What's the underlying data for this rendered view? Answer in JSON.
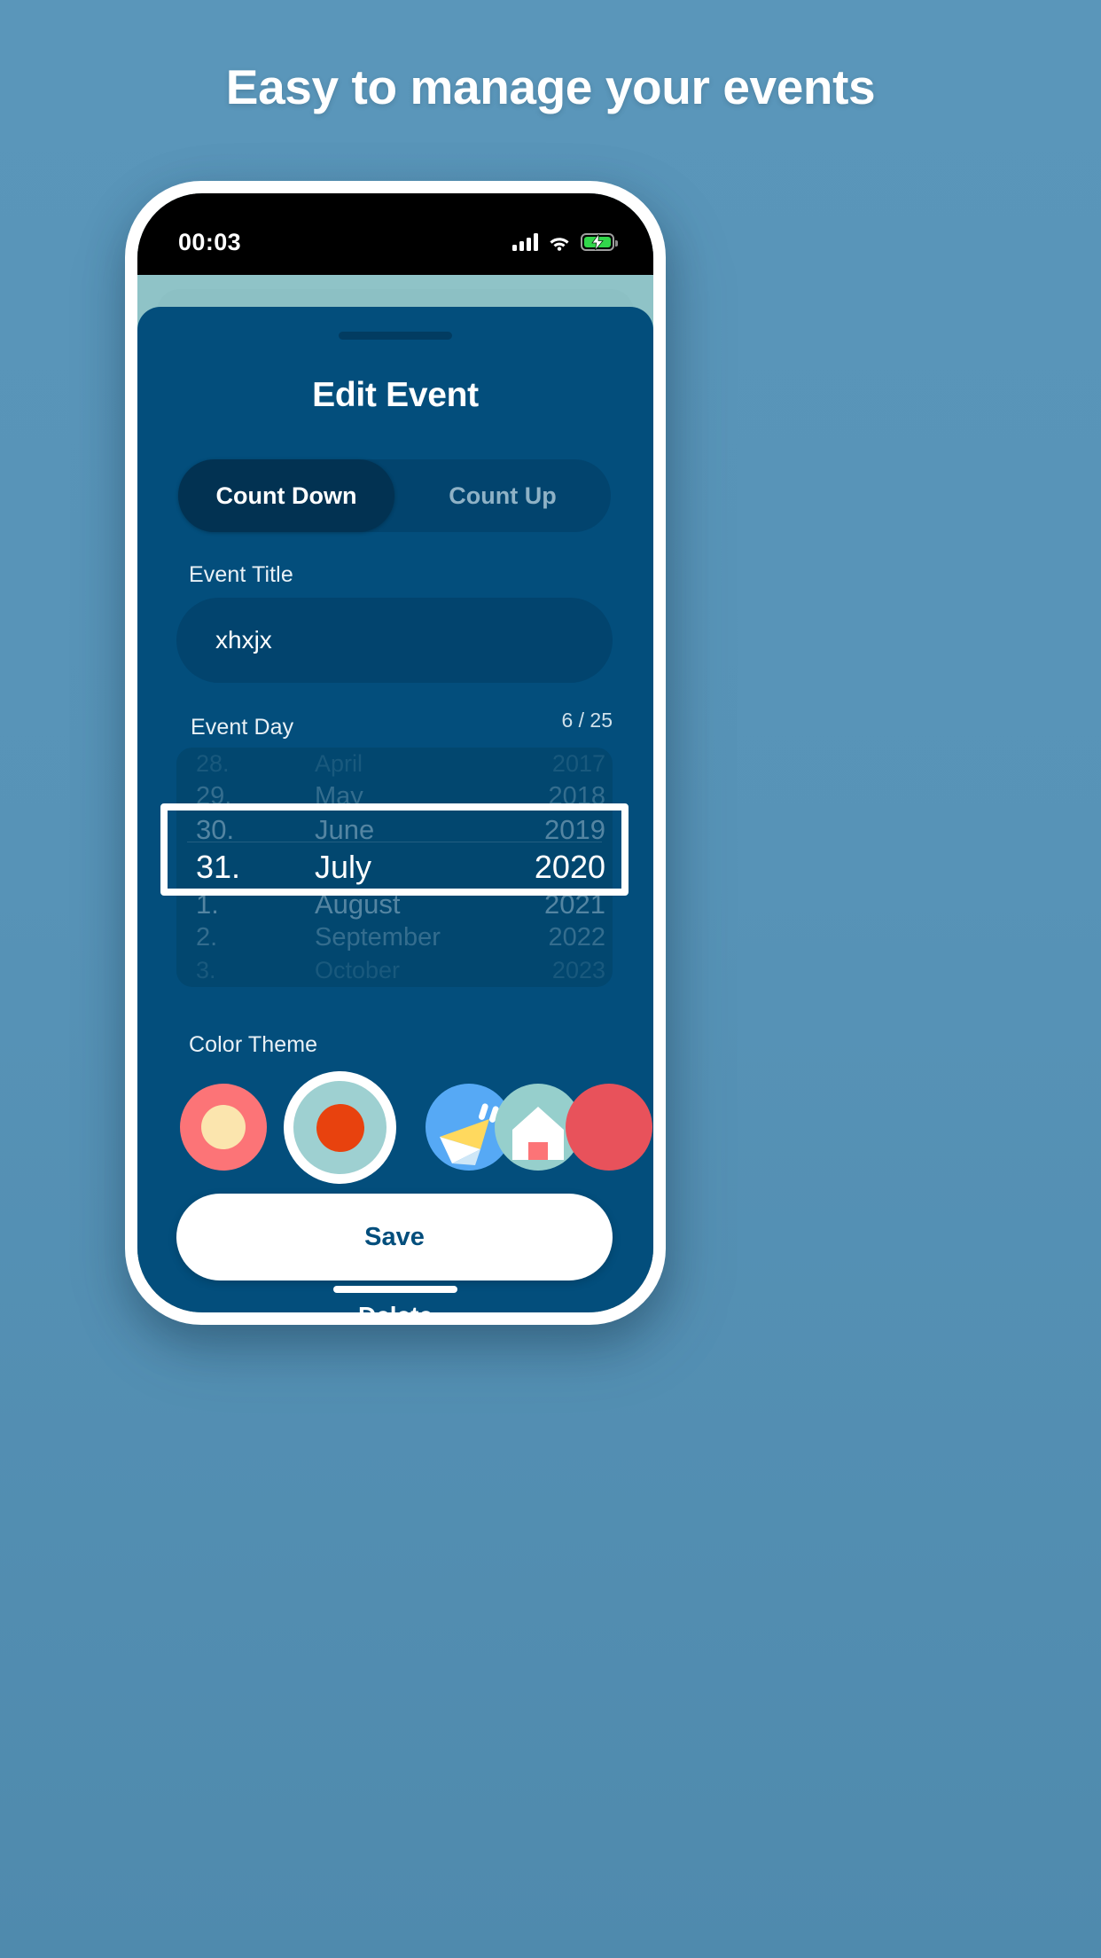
{
  "promo": {
    "headline": "Easy to manage your events",
    "background_color": "#5793b7"
  },
  "status_bar": {
    "time": "00:03",
    "signal_icon": "cellular-bars-icon",
    "wifi_icon": "wifi-icon",
    "battery_icon": "battery-charging-icon",
    "battery_color": "#32d74b"
  },
  "sheet": {
    "title": "Edit Event",
    "background_color": "#034e7c",
    "grabber": "drag-handle"
  },
  "segmented_control": {
    "options": [
      {
        "label": "Count Down",
        "selected": true
      },
      {
        "label": "Count Up",
        "selected": false
      }
    ],
    "active_background": "#023252"
  },
  "event_title": {
    "label": "Event Title",
    "value": "xhxjx",
    "placeholder": "Event Title",
    "char_count": "6 / 25"
  },
  "event_day": {
    "label": "Event Day",
    "selected": {
      "day": "31.",
      "month": "July",
      "year": "2020"
    },
    "days": [
      "28.",
      "29.",
      "30.",
      "31.",
      "1.",
      "2.",
      "3."
    ],
    "months": [
      "April",
      "May",
      "June",
      "July",
      "August",
      "September",
      "October"
    ],
    "years": [
      "2017",
      "2018",
      "2019",
      "2020",
      "2021",
      "2022",
      "2023"
    ]
  },
  "color_theme": {
    "label": "Color Theme",
    "swatches": [
      {
        "name": "swatch-coral",
        "ring": "#fc7477",
        "center": "#fbe5ae",
        "selected": false
      },
      {
        "name": "swatch-teal",
        "ring": "#9ed0d1",
        "center": "#e8420e",
        "selected": true
      },
      {
        "name": "swatch-blue",
        "ring": "#56a9f5",
        "center": "#ffe27a",
        "selected": false
      },
      {
        "name": "swatch-mint",
        "ring": "#96cfcc",
        "center": "#ffffff",
        "selected": false
      },
      {
        "name": "swatch-red",
        "ring": "#e8525b",
        "center": "#e8525b",
        "selected": false
      }
    ]
  },
  "actions": {
    "save_label": "Save",
    "delete_label": "Delete"
  }
}
